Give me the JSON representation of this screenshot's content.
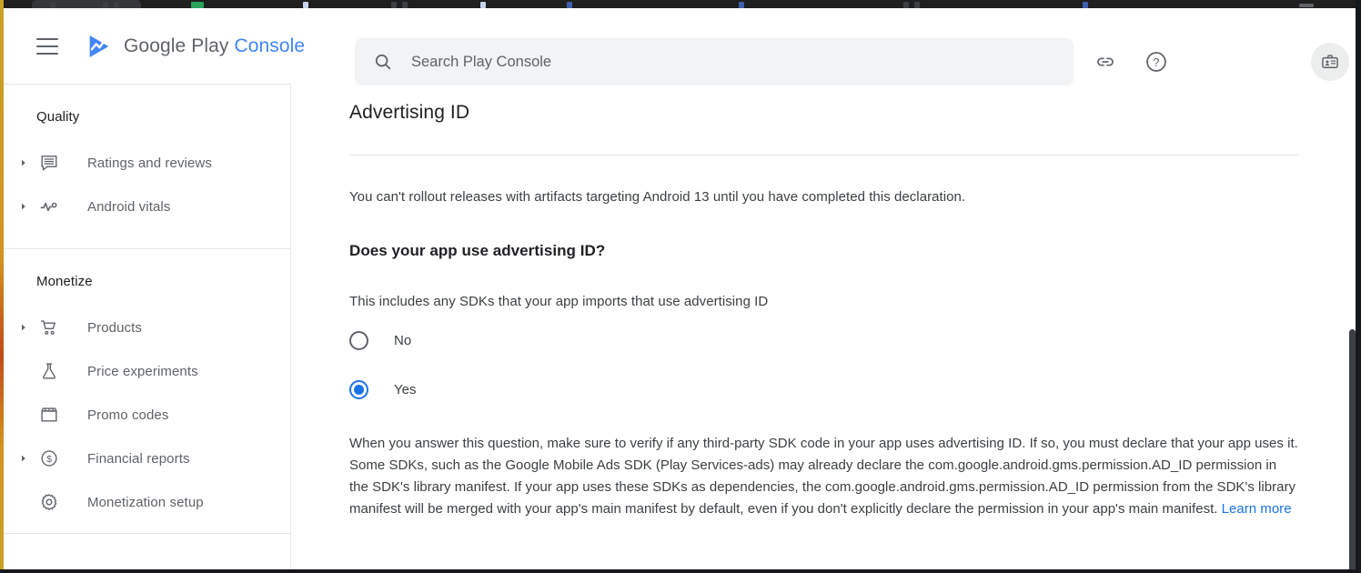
{
  "header": {
    "brand_google_play": "Google Play",
    "brand_console": "Console",
    "menu_icon": "hamburger-menu-icon",
    "logo_icon": "google-play-logo-icon",
    "link_icon": "link-icon",
    "help_icon": "help-circle-icon",
    "badge_icon": "id-badge-icon"
  },
  "search": {
    "placeholder": "Search Play Console",
    "value": "",
    "icon": "search-icon"
  },
  "sidebar": {
    "sections": [
      {
        "title": "Quality",
        "items": [
          {
            "label": "Ratings and reviews",
            "icon": "reviews-icon",
            "expandable": true
          },
          {
            "label": "Android vitals",
            "icon": "vitals-pulse-icon",
            "expandable": true
          }
        ]
      },
      {
        "title": "Monetize",
        "items": [
          {
            "label": "Products",
            "icon": "shopping-cart-icon",
            "expandable": true
          },
          {
            "label": "Price experiments",
            "icon": "flask-icon",
            "expandable": false
          },
          {
            "label": "Promo codes",
            "icon": "storefront-icon",
            "expandable": false
          },
          {
            "label": "Financial reports",
            "icon": "dollar-circle-icon",
            "expandable": true
          },
          {
            "label": "Monetization setup",
            "icon": "gear-icon",
            "expandable": false
          }
        ]
      }
    ]
  },
  "main": {
    "page_title": "Advertising ID",
    "notice": "You can't rollout releases with artifacts targeting Android 13 until you have completed this declaration.",
    "question": "Does your app use advertising ID?",
    "sub_note": "This includes any SDKs that your app imports that use advertising ID",
    "radio_options": [
      {
        "label": "No",
        "selected": false
      },
      {
        "label": "Yes",
        "selected": true
      }
    ],
    "long_note": "When you answer this question, make sure to verify if any third-party SDK code in your app uses advertising ID. If so, you must declare that your app uses it. Some SDKs, such as the Google Mobile Ads SDK (Play Services-ads) may already declare the com.google.android.gms.permission.AD_ID permission in the SDK's library manifest. If your app uses these SDKs as dependencies, the com.google.android.gms.permission.AD_ID permission from the SDK's library manifest will be merged with your app's main manifest by default, even if you don't explicitly declare the permission in your app's main manifest. ",
    "learn_more": "Learn more"
  },
  "colors": {
    "accent_blue": "#1a73e8",
    "brand_blue": "#4285f4",
    "text_primary": "#202124",
    "text_secondary": "#5f6368",
    "search_bg": "#f1f3f4",
    "divider": "#e4e6e8"
  }
}
